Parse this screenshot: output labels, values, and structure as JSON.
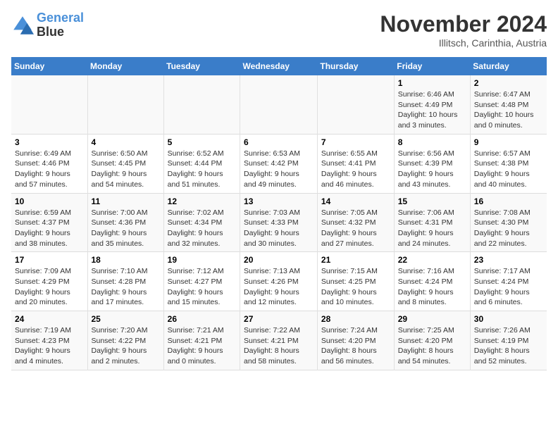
{
  "logo": {
    "line1": "General",
    "line2": "Blue"
  },
  "title": "November 2024",
  "subtitle": "Illitsch, Carinthia, Austria",
  "days_of_week": [
    "Sunday",
    "Monday",
    "Tuesday",
    "Wednesday",
    "Thursday",
    "Friday",
    "Saturday"
  ],
  "weeks": [
    [
      {
        "day": "",
        "info": ""
      },
      {
        "day": "",
        "info": ""
      },
      {
        "day": "",
        "info": ""
      },
      {
        "day": "",
        "info": ""
      },
      {
        "day": "",
        "info": ""
      },
      {
        "day": "1",
        "info": "Sunrise: 6:46 AM\nSunset: 4:49 PM\nDaylight: 10 hours and 3 minutes."
      },
      {
        "day": "2",
        "info": "Sunrise: 6:47 AM\nSunset: 4:48 PM\nDaylight: 10 hours and 0 minutes."
      }
    ],
    [
      {
        "day": "3",
        "info": "Sunrise: 6:49 AM\nSunset: 4:46 PM\nDaylight: 9 hours and 57 minutes."
      },
      {
        "day": "4",
        "info": "Sunrise: 6:50 AM\nSunset: 4:45 PM\nDaylight: 9 hours and 54 minutes."
      },
      {
        "day": "5",
        "info": "Sunrise: 6:52 AM\nSunset: 4:44 PM\nDaylight: 9 hours and 51 minutes."
      },
      {
        "day": "6",
        "info": "Sunrise: 6:53 AM\nSunset: 4:42 PM\nDaylight: 9 hours and 49 minutes."
      },
      {
        "day": "7",
        "info": "Sunrise: 6:55 AM\nSunset: 4:41 PM\nDaylight: 9 hours and 46 minutes."
      },
      {
        "day": "8",
        "info": "Sunrise: 6:56 AM\nSunset: 4:39 PM\nDaylight: 9 hours and 43 minutes."
      },
      {
        "day": "9",
        "info": "Sunrise: 6:57 AM\nSunset: 4:38 PM\nDaylight: 9 hours and 40 minutes."
      }
    ],
    [
      {
        "day": "10",
        "info": "Sunrise: 6:59 AM\nSunset: 4:37 PM\nDaylight: 9 hours and 38 minutes."
      },
      {
        "day": "11",
        "info": "Sunrise: 7:00 AM\nSunset: 4:36 PM\nDaylight: 9 hours and 35 minutes."
      },
      {
        "day": "12",
        "info": "Sunrise: 7:02 AM\nSunset: 4:34 PM\nDaylight: 9 hours and 32 minutes."
      },
      {
        "day": "13",
        "info": "Sunrise: 7:03 AM\nSunset: 4:33 PM\nDaylight: 9 hours and 30 minutes."
      },
      {
        "day": "14",
        "info": "Sunrise: 7:05 AM\nSunset: 4:32 PM\nDaylight: 9 hours and 27 minutes."
      },
      {
        "day": "15",
        "info": "Sunrise: 7:06 AM\nSunset: 4:31 PM\nDaylight: 9 hours and 24 minutes."
      },
      {
        "day": "16",
        "info": "Sunrise: 7:08 AM\nSunset: 4:30 PM\nDaylight: 9 hours and 22 minutes."
      }
    ],
    [
      {
        "day": "17",
        "info": "Sunrise: 7:09 AM\nSunset: 4:29 PM\nDaylight: 9 hours and 20 minutes."
      },
      {
        "day": "18",
        "info": "Sunrise: 7:10 AM\nSunset: 4:28 PM\nDaylight: 9 hours and 17 minutes."
      },
      {
        "day": "19",
        "info": "Sunrise: 7:12 AM\nSunset: 4:27 PM\nDaylight: 9 hours and 15 minutes."
      },
      {
        "day": "20",
        "info": "Sunrise: 7:13 AM\nSunset: 4:26 PM\nDaylight: 9 hours and 12 minutes."
      },
      {
        "day": "21",
        "info": "Sunrise: 7:15 AM\nSunset: 4:25 PM\nDaylight: 9 hours and 10 minutes."
      },
      {
        "day": "22",
        "info": "Sunrise: 7:16 AM\nSunset: 4:24 PM\nDaylight: 9 hours and 8 minutes."
      },
      {
        "day": "23",
        "info": "Sunrise: 7:17 AM\nSunset: 4:24 PM\nDaylight: 9 hours and 6 minutes."
      }
    ],
    [
      {
        "day": "24",
        "info": "Sunrise: 7:19 AM\nSunset: 4:23 PM\nDaylight: 9 hours and 4 minutes."
      },
      {
        "day": "25",
        "info": "Sunrise: 7:20 AM\nSunset: 4:22 PM\nDaylight: 9 hours and 2 minutes."
      },
      {
        "day": "26",
        "info": "Sunrise: 7:21 AM\nSunset: 4:21 PM\nDaylight: 9 hours and 0 minutes."
      },
      {
        "day": "27",
        "info": "Sunrise: 7:22 AM\nSunset: 4:21 PM\nDaylight: 8 hours and 58 minutes."
      },
      {
        "day": "28",
        "info": "Sunrise: 7:24 AM\nSunset: 4:20 PM\nDaylight: 8 hours and 56 minutes."
      },
      {
        "day": "29",
        "info": "Sunrise: 7:25 AM\nSunset: 4:20 PM\nDaylight: 8 hours and 54 minutes."
      },
      {
        "day": "30",
        "info": "Sunrise: 7:26 AM\nSunset: 4:19 PM\nDaylight: 8 hours and 52 minutes."
      }
    ]
  ]
}
